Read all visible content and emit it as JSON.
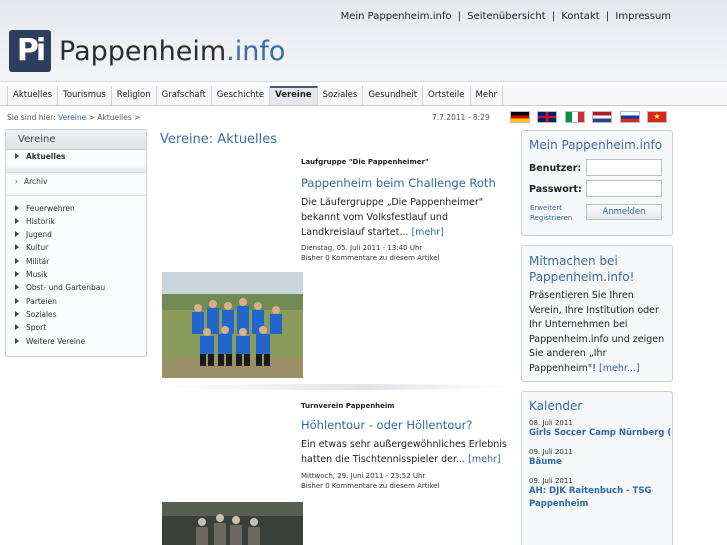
{
  "header": {
    "logo_text": "Pappenheim",
    "logo_tld": ".info",
    "logo_mark": "Pi",
    "links": [
      "Mein Pappenheim.info",
      "Seitenübersicht",
      "Kontakt",
      "Impressum"
    ],
    "separator": "|"
  },
  "nav": {
    "items": [
      "Aktuelles",
      "Tourismus",
      "Religion",
      "Grafschaft",
      "Geschichte",
      "Vereine",
      "Soziales",
      "Gesundheit",
      "Ortsteile",
      "Mehr"
    ],
    "active": "Vereine"
  },
  "breadcrumb": {
    "prefix": "Sie sind hier:",
    "link": "Vereine",
    "sep1": ">",
    "current": "Aktuelles",
    "sep2": ">"
  },
  "datetime": "7.7.2011 - 8:29",
  "flags": [
    {
      "name": "german-flag",
      "colors": [
        "#000000",
        "#dd0000",
        "#ffce00"
      ]
    },
    {
      "name": "english-flag",
      "colors": [
        "#012169",
        "#ffffff",
        "#c8102e"
      ]
    },
    {
      "name": "italian-flag",
      "colors": [
        "#009246",
        "#ffffff",
        "#ce2b37"
      ]
    },
    {
      "name": "dutch-flag",
      "colors": [
        "#ae1c28",
        "#ffffff",
        "#21468b"
      ]
    },
    {
      "name": "russian-flag",
      "colors": [
        "#ffffff",
        "#0039a6",
        "#d52b1e"
      ]
    },
    {
      "name": "vietnamese-flag",
      "colors": [
        "#da251d",
        "#ffff00"
      ]
    }
  ],
  "sidebar": {
    "title": "Vereine",
    "active": "Aktuelles",
    "archiv": "Archiv",
    "items": [
      "Feuerwehren",
      "Historik",
      "Jugend",
      "Kultur",
      "Militär",
      "Musik",
      "Obst- und Gartenbau",
      "Parteien",
      "Soziales",
      "Sport",
      "Weitere Vereine"
    ]
  },
  "main": {
    "title": "Vereine: Aktuelles",
    "articles": [
      {
        "kicker": "Laufgruppe \"Die Pappenheimer\"",
        "title": "Pappenheim beim Challenge Roth",
        "teaser": "Die Läufergruppe „Die Pappenheimer\" bekannt vom Volksfestlauf und Landkreislauf startet...",
        "more": "[mehr]",
        "date": "Dienstag, 05. Juli 2011 - 13:40 Uhr",
        "comments": "Bisher 0 Kommentare zu diesem Artikel"
      },
      {
        "kicker": "Turnverein Pappenheim",
        "title": "Höhlentour - oder Höllentour?",
        "teaser": "Ein etwas sehr außergewöhnliches Erlebnis hatten die Tischtennisspieler der...",
        "more": "[mehr]",
        "date": "Mittwoch, 29. Juni 2011 - 23:52 Uhr",
        "comments": "Bisher 0 Kommentare zu diesem Artikel"
      }
    ]
  },
  "login": {
    "title": "Mein Pappenheim.info",
    "user_label": "Benutzer:",
    "pass_label": "Passwort:",
    "link_forgot": "Erweitert",
    "link_register": "Registrieren",
    "button": "Anmelden"
  },
  "promo": {
    "title": "Mitmachen bei Pappenheim.info!",
    "text": "Präsentieren Sie Ihren Verein, Ihre Institution oder Ihr Unternehmen bei Pappenheim.info und zeigen Sie anderen „Ihr Pappenheim\"!",
    "more": "[mehr...]"
  },
  "calendar": {
    "title": "Kalender",
    "entries": [
      {
        "date": "08. Juli 2011",
        "title": "Girls Soccer Camp Nürnberg ("
      },
      {
        "date": "09. Juli 2011",
        "title": "Bäume"
      },
      {
        "date": "09. Juli 2011",
        "title": "AH: DJK Raitenbuch - TSG Pappenheim"
      }
    ]
  }
}
